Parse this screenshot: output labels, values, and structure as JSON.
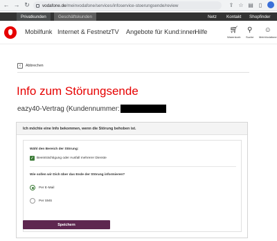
{
  "browser": {
    "url_host": "vodafone.de",
    "url_path": "/meinvodafone/services/infoservice-stoerungsende/review"
  },
  "topbar": {
    "tabs": [
      "Privatkunden",
      "Geschäftskunden"
    ],
    "links": [
      "Netz",
      "Kontakt",
      "Shopfinder"
    ]
  },
  "nav": {
    "items": [
      "Mobilfunk",
      "Internet & Festnetz",
      "TV",
      "Angebote für Kund:innen",
      "Hilfe"
    ],
    "util": [
      "Warenkorb",
      "Suche",
      "MeinVodafone"
    ]
  },
  "page": {
    "back_label": "Abbrechen",
    "title": "Info zum Störungsende",
    "contract_prefix": "eazy40-Vertrag (Kundennummer:"
  },
  "card": {
    "header": "Ich möchte eine Info bekommen, wenn die Störung behoben ist.",
    "q1": "Wähl den Bereich der Störung:",
    "option_checked": "Beeinträchtigung oder Ausfall mehrerer Dienste",
    "q2": "Wie sollen wir Dich über das Ende der Störung informieren?",
    "radio_email": "Per E-Mail",
    "radio_sms": "Per SMS",
    "save_label": "Speichern"
  },
  "colors": {
    "brand_red": "#e60000",
    "save_button": "#5e2750",
    "check_green": "#3e7d3a"
  }
}
